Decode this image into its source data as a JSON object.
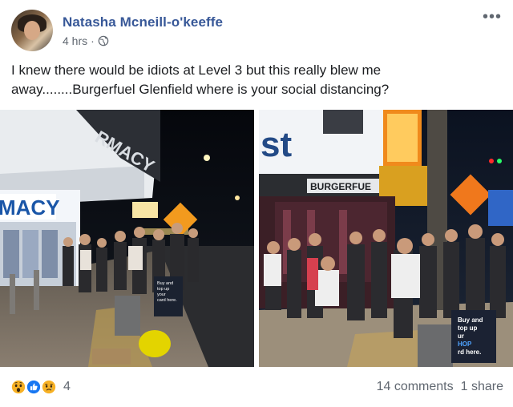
{
  "post": {
    "author_name": "Natasha Mcneill-o'keeffe",
    "time": "4 hrs",
    "separator": "·",
    "privacy_icon": "globe-icon",
    "more_icon": "more-options-icon",
    "more_label": "•••",
    "text": "I knew there would be idiots at Level 3 but this really blew me away........Burgerfuel Glenfield where is your social distancing?"
  },
  "photos": [
    {
      "name": "photo-left",
      "signs": {
        "pharmacy": "MACY",
        "pharmacy_top": "RMACY",
        "board": [
          "Buy and",
          "top up",
          "your",
          "card here."
        ]
      }
    },
    {
      "name": "photo-right",
      "signs": {
        "store_top": "st",
        "store": "BURGERFUE",
        "board": [
          "Buy and",
          "top up",
          "ur",
          "HOP",
          "rd here."
        ]
      }
    }
  ],
  "footer": {
    "reactions": [
      "wow-icon",
      "like-icon",
      "sad-icon"
    ],
    "reaction_count": "4",
    "comments": "14 comments",
    "shares": "1 share"
  },
  "colors": {
    "link": "#385898",
    "secondary": "#606770",
    "like": "#1877f2",
    "wow": "#f7b125"
  }
}
